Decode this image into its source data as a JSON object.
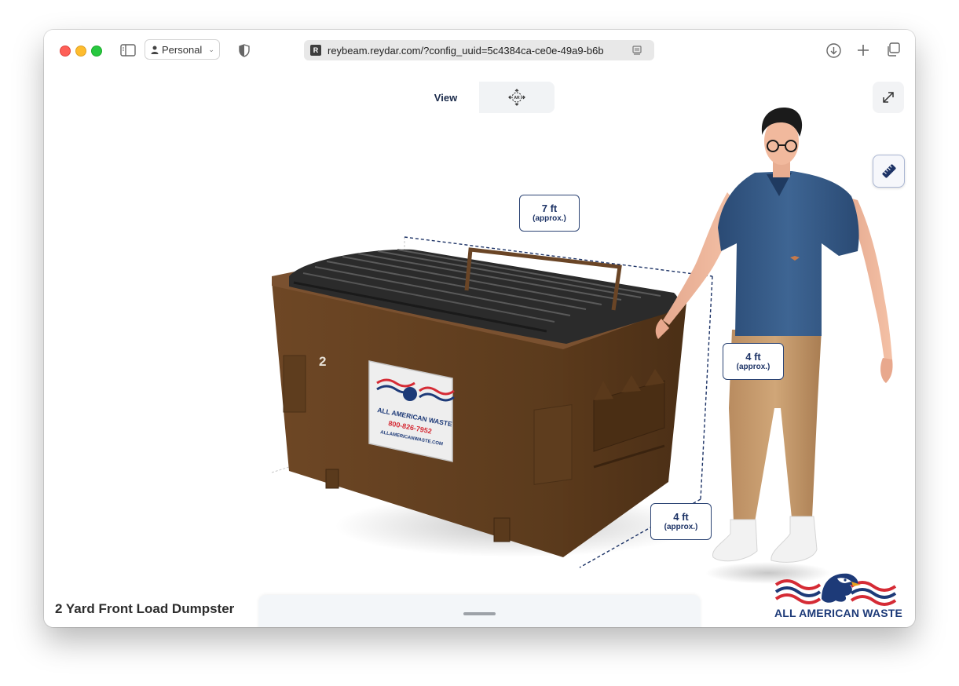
{
  "browser": {
    "profile_label": "Personal",
    "url": "reybeam.reydar.com/?config_uuid=5c4384ca-ce0e-49a9-b6b",
    "favicon_letter": "R"
  },
  "viewer": {
    "view_tab_label": "View",
    "ar_icon_label": "AR",
    "dimensions": [
      {
        "value": "7 ft",
        "note": "(approx.)"
      },
      {
        "value": "4 ft",
        "note": "(approx.)"
      },
      {
        "value": "4 ft",
        "note": "(approx.)"
      }
    ],
    "product_name": "2 Yard Front Load Dumpster",
    "dumpster_number": "2",
    "sign": {
      "company": "ALL AMERICAN WASTE",
      "phone": "800-826-7952",
      "website": "ALLAMERICANWASTE.COM"
    },
    "brand_name": "ALL AMERICAN WASTE"
  },
  "colors": {
    "accent_navy": "#1d3366",
    "dumpster_brown": "#6b4322",
    "lid_black": "#2a2a2a",
    "brand_red": "#d52b35",
    "brand_blue": "#1d3a78"
  }
}
